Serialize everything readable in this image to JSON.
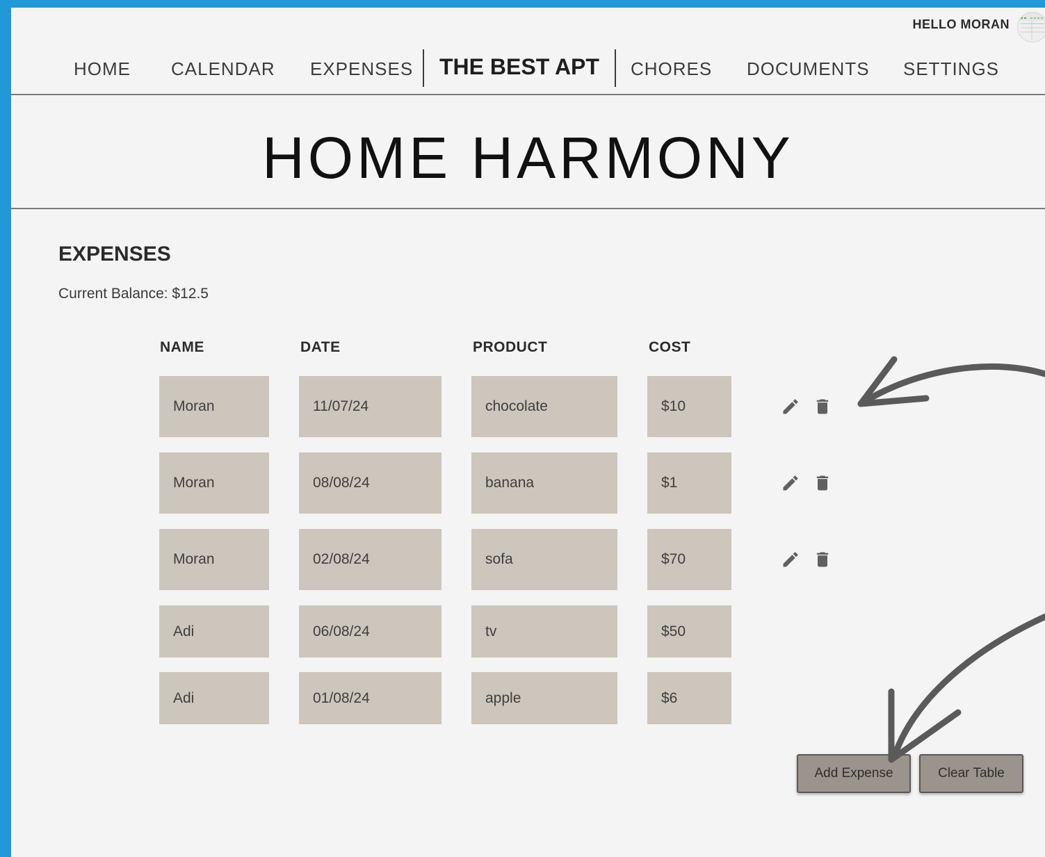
{
  "header": {
    "greeting": "HELLO MORAN",
    "nav": {
      "home": "HOME",
      "calendar": "CALENDAR",
      "expenses": "EXPENSES",
      "brand": "THE BEST APT",
      "chores": "CHORES",
      "documents": "DOCUMENTS",
      "settings": "SETTINGS"
    }
  },
  "page": {
    "title": "HOME HARMONY",
    "section_title": "EXPENSES",
    "balance_label": "Current Balance: ",
    "balance_value": "$12.5"
  },
  "table": {
    "columns": {
      "name": "NAME",
      "date": "DATE",
      "product": "PRODUCT",
      "cost": "COST"
    },
    "rows": [
      {
        "name": "Moran",
        "date": "11/07/24",
        "product": "chocolate",
        "cost": "$10",
        "editable": true
      },
      {
        "name": "Moran",
        "date": "08/08/24",
        "product": "banana",
        "cost": "$1",
        "editable": true
      },
      {
        "name": "Moran",
        "date": "02/08/24",
        "product": "sofa",
        "cost": "$70",
        "editable": true
      },
      {
        "name": "Adi",
        "date": "06/08/24",
        "product": "tv",
        "cost": "$50",
        "editable": false
      },
      {
        "name": "Adi",
        "date": "01/08/24",
        "product": "apple",
        "cost": "$6",
        "editable": false
      }
    ]
  },
  "actions": {
    "add_expense": "Add Expense",
    "clear_table": "Clear Table"
  },
  "icons": {
    "edit": "pencil-icon",
    "delete": "trash-icon",
    "avatar": "avatar-icon"
  },
  "colors": {
    "border": "#2199d6",
    "background": "#f4f4f4",
    "cell": "#ccc6bc",
    "button": "#9a948d",
    "icon": "#606060"
  }
}
